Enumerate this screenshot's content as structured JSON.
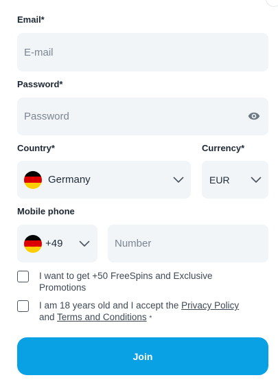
{
  "email": {
    "label": "Email*",
    "placeholder": "E-mail"
  },
  "password": {
    "label": "Password*",
    "placeholder": "Password",
    "toggle_icon": "eye-icon"
  },
  "country": {
    "label": "Country*",
    "value": "Germany",
    "flag": "germany-flag"
  },
  "currency": {
    "label": "Currency*",
    "value": "EUR"
  },
  "phone": {
    "label": "Mobile phone",
    "code": "+49",
    "placeholder": "Number"
  },
  "consents": {
    "freespins": "I want to get +50 FreeSpins and Exclusive Promotions",
    "age_prefix": "I am 18 years old and I accept the ",
    "privacy_link": "Privacy Policy",
    "and_text": "and",
    "terms_link": "Terms and Conditions",
    "required_mark": "*"
  },
  "join_label": "Join",
  "colors": {
    "accent": "#0aa0e4",
    "field_bg": "#f1f5f8",
    "flag_black": "#000000",
    "flag_red": "#dd0000",
    "flag_gold": "#ffce00"
  }
}
